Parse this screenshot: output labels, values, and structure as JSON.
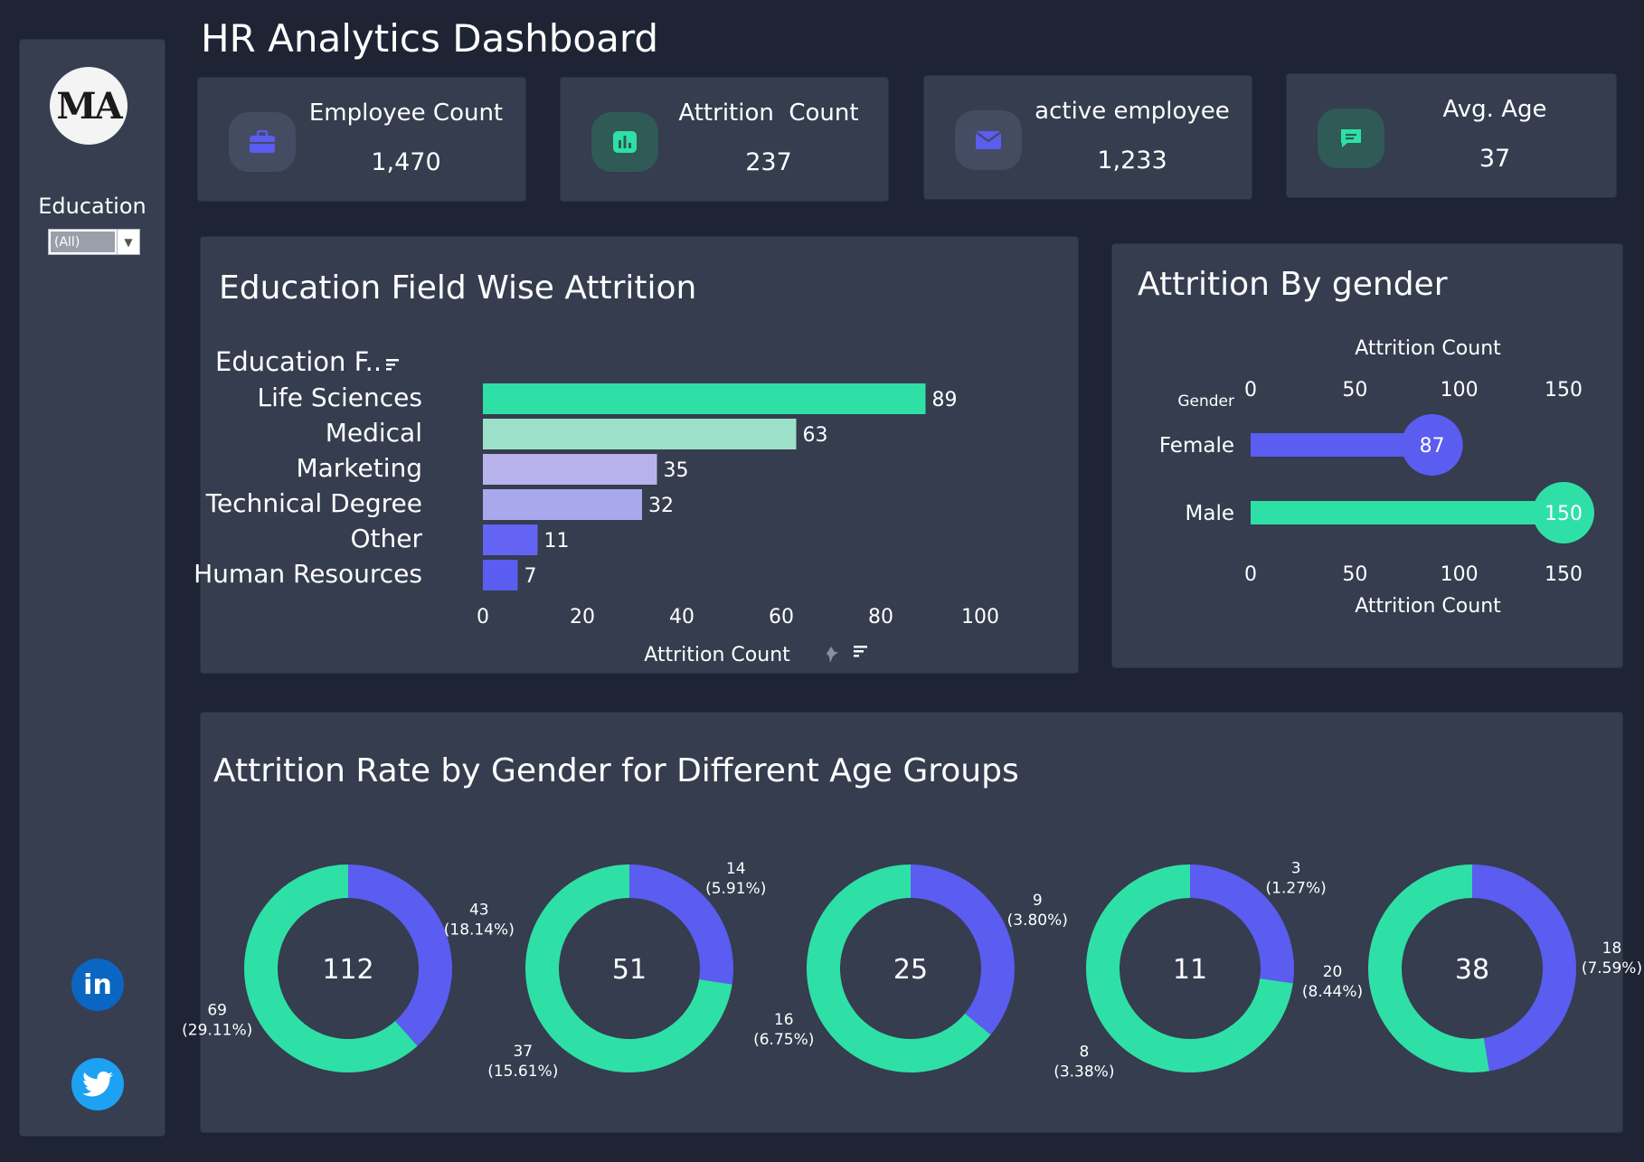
{
  "header": {
    "title": "HR Analytics Dashboard"
  },
  "sidebar": {
    "logo_text": "MA",
    "filter_label": "Education",
    "filter_value": "(All)"
  },
  "kpis": [
    {
      "label": "Employee Count",
      "value": "1,470",
      "icon": "briefcase-icon",
      "icon_color": "#5b5cf0"
    },
    {
      "label": "Attrition  Count",
      "value": "237",
      "icon": "bar-chart-icon",
      "icon_color": "#2fe0a6"
    },
    {
      "label": "active employee",
      "value": "1,233",
      "icon": "envelope-icon",
      "icon_color": "#5b5cf0"
    },
    {
      "label": "Avg. Age",
      "value": "37",
      "icon": "chat-icon",
      "icon_color": "#2fe0a6"
    }
  ],
  "colors": {
    "accent_purple": "#5b5cf0",
    "accent_green": "#2fe0a6",
    "panel": "#353d4f",
    "background": "#1e2433"
  },
  "panels": {
    "education_title": "Education Field Wise Attrition",
    "gender_title": "Attrition By gender",
    "age_title": "Attrition Rate by Gender for Different Age Groups"
  },
  "chart_data": [
    {
      "type": "bar",
      "orientation": "horizontal",
      "title": "Education Field Wise Attrition",
      "ylabel": "Education F..",
      "xlabel": "Attrition Count",
      "categories": [
        "Life Sciences",
        "Medical",
        "Marketing",
        "Technical Degree",
        "Other",
        "Human Resources"
      ],
      "values": [
        89,
        63,
        35,
        32,
        11,
        7
      ],
      "bar_colors": [
        "#2fe0a6",
        "#9de0c9",
        "#b7b3ea",
        "#a9a8ec",
        "#6363f4",
        "#5b5cf0"
      ],
      "xlim": [
        0,
        100
      ],
      "xticks": [
        0,
        20,
        40,
        60,
        80,
        100
      ],
      "grid": false
    },
    {
      "type": "bar",
      "orientation": "horizontal",
      "style": "lollipop",
      "title": "Attrition By gender",
      "ylabel": "Gender",
      "xlabel": "Attrition Count",
      "categories": [
        "Female",
        "Male"
      ],
      "values": [
        87,
        150
      ],
      "colors": [
        "#5b5cf0",
        "#2fe0a6"
      ],
      "xlim": [
        0,
        150
      ],
      "xticks": [
        0,
        50,
        100,
        150
      ]
    },
    {
      "type": "pie",
      "style": "donut",
      "title": "Attrition Rate by Gender for Different Age Groups",
      "series_colors": {
        "first": "#5b5cf0",
        "second": "#2fe0a6"
      },
      "donuts": [
        {
          "total": "112",
          "slices": [
            {
              "value": 43,
              "pct": "18.14%"
            },
            {
              "value": 69,
              "pct": "29.11%"
            }
          ]
        },
        {
          "total": "51",
          "slices": [
            {
              "value": 14,
              "pct": "5.91%"
            },
            {
              "value": 37,
              "pct": "15.61%"
            }
          ]
        },
        {
          "total": "25",
          "slices": [
            {
              "value": 9,
              "pct": "3.80%"
            },
            {
              "value": 16,
              "pct": "6.75%"
            }
          ]
        },
        {
          "total": "11",
          "slices": [
            {
              "value": 3,
              "pct": "1.27%"
            },
            {
              "value": 8,
              "pct": "3.38%"
            }
          ]
        },
        {
          "total": "38",
          "slices": [
            {
              "value": 18,
              "pct": "7.59%"
            },
            {
              "value": 20,
              "pct": "8.44%"
            }
          ]
        }
      ]
    }
  ]
}
